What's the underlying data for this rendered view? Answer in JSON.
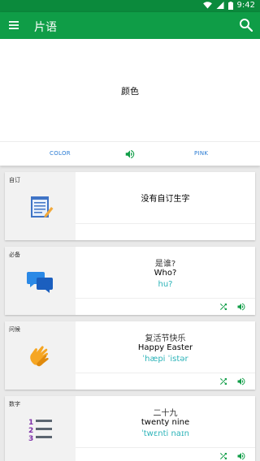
{
  "status": {
    "time": "9:42"
  },
  "appbar": {
    "title": "片语",
    "menu_icon": "menu-icon",
    "search_icon": "search-icon"
  },
  "hero": {
    "word": "颜色"
  },
  "langbar": {
    "source_lang": "COLOR",
    "target_lang": "PINK",
    "speaker_icon": "speaker-icon"
  },
  "colors": {
    "primary": "#0f9d47",
    "status": "#0b8a3c",
    "accent_blue": "#2a7bd3",
    "phonetic": "#2bb3b8"
  },
  "cards": [
    {
      "category": "自订",
      "icon": "notepad-icon",
      "empty_text": "没有自订生字"
    },
    {
      "category": "必备",
      "icon": "chat-bubbles-icon",
      "native": "是谁?",
      "english": "Who?",
      "phonetic": "hu?"
    },
    {
      "category": "问候",
      "icon": "clapping-hands-icon",
      "native": "复活节快乐",
      "english": "Happy Easter",
      "phonetic": "ˈhæpi ˈistər"
    },
    {
      "category": "数字",
      "icon": "numbered-list-icon",
      "native": "二十九",
      "english": "twenty nine",
      "phonetic": "ˈtwɛnti naɪn"
    }
  ]
}
